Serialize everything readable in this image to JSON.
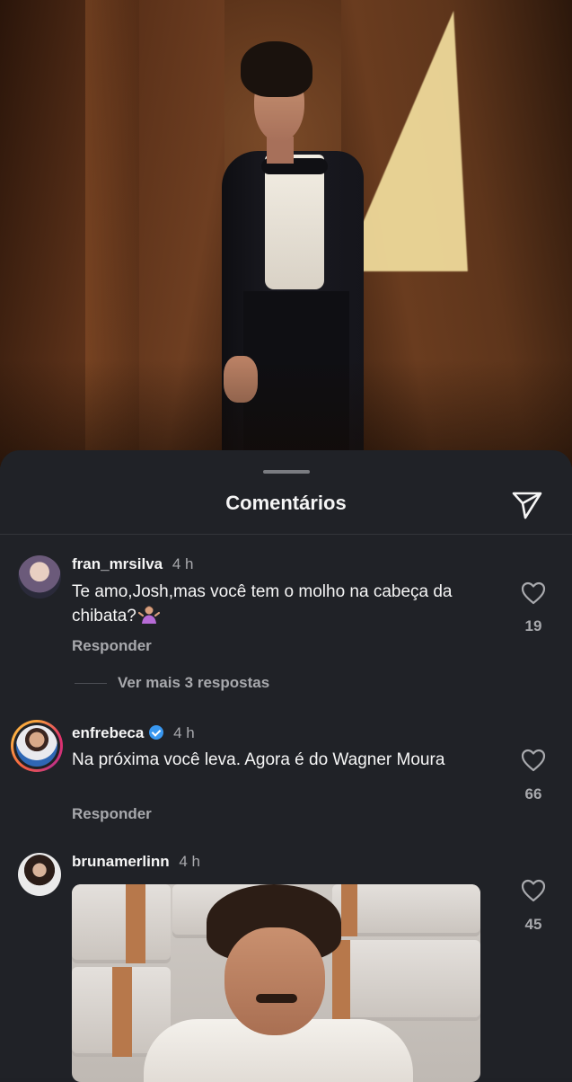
{
  "sheet": {
    "title": "Comentários"
  },
  "comments": [
    {
      "username": "fran_mrsilva",
      "time": "4 h",
      "text": "Te amo,Josh,mas você tem o molho na cabeça da chibata?",
      "emoji": "person-shrugging",
      "reply_label": "Responder",
      "likes": "19",
      "more_replies": "Ver mais 3 respostas"
    },
    {
      "username": "enfrebeca",
      "verified": true,
      "time": "4 h",
      "text": "Na próxima você leva. Agora é do Wagner Moura",
      "reply_label": "Responder",
      "likes": "66"
    },
    {
      "username": "brunamerlinn",
      "time": "4 h",
      "media": "gif-image",
      "likes": "45"
    }
  ],
  "colors": {
    "background": "#202227",
    "text": "#f5f5f5",
    "muted": "#a8a9ad",
    "verified": "#3897f0"
  },
  "icons": [
    "send-icon",
    "heart-icon",
    "verified-badge-icon"
  ]
}
